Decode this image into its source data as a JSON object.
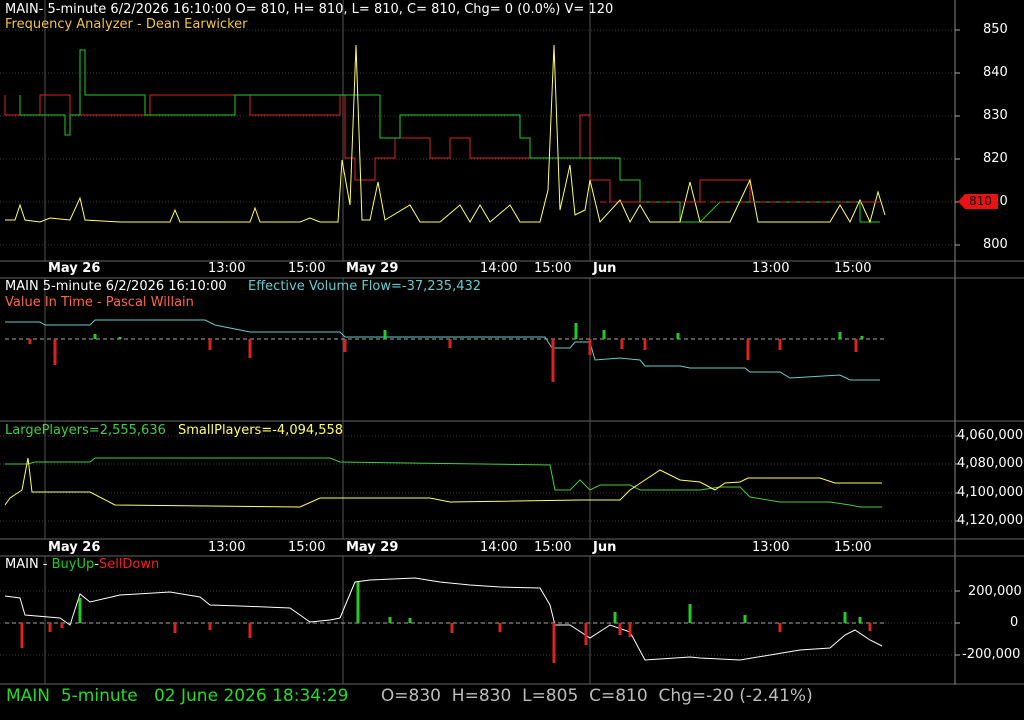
{
  "header": {
    "title_line": "MAIN- 5-minute 6/2/2026 16:10:00 O= 810, H= 810, L= 810, C= 810, Chg= 0 (0.0%) V= 120",
    "indicator_line": "Frequency Analyzer - Dean Earwicker"
  },
  "panel1": {
    "y_ticks": [
      "850",
      "840",
      "830",
      "820",
      "810",
      "800"
    ],
    "price_badge": "810"
  },
  "x_axis": {
    "labels": [
      {
        "text": "May 26",
        "major": true
      },
      {
        "text": "13:00",
        "major": false
      },
      {
        "text": "15:00",
        "major": false
      },
      {
        "text": "May 29",
        "major": true
      },
      {
        "text": "14:00",
        "major": false
      },
      {
        "text": "15:00",
        "major": false
      },
      {
        "text": "Jun",
        "major": true
      },
      {
        "text": "13:00",
        "major": false
      },
      {
        "text": "15:00",
        "major": false
      }
    ]
  },
  "panel2": {
    "label_main": "MAIN 5-minute  6/2/2026 16:10:00",
    "label_evf": "Effective Volume Flow=-37,235,432",
    "label_vit": "Value In Time - Pascal Willain"
  },
  "panel3": {
    "label_large": "LargePlayers=2,555,636",
    "label_small": "SmallPlayers=-4,094,558",
    "y_ticks": [
      "4,060,000",
      "4,080,000",
      "4,100,000",
      "4,120,000"
    ]
  },
  "panel4": {
    "label_main": "MAIN - ",
    "label_buy": "BuyUp",
    "label_dash": "-",
    "label_sell": "SellDown",
    "y_ticks": [
      "200,000",
      "0",
      "-200,000"
    ]
  },
  "status_bar": {
    "symbol": "MAIN",
    "interval": "5-minute",
    "datetime": "02 June 2026 18:34:29",
    "open": "O=830",
    "high": "H=830",
    "low": "L=805",
    "close": "C=810",
    "change": "Chg=-20 (-2.41%)"
  },
  "colors": {
    "background": "#000000",
    "grid": "#3a3a3a",
    "up": "#22cc22",
    "down": "#dd2222",
    "yellow": "#ffff66",
    "cyan": "#66cccc",
    "orange": "#ff6644",
    "status_green": "#22dd22"
  }
}
